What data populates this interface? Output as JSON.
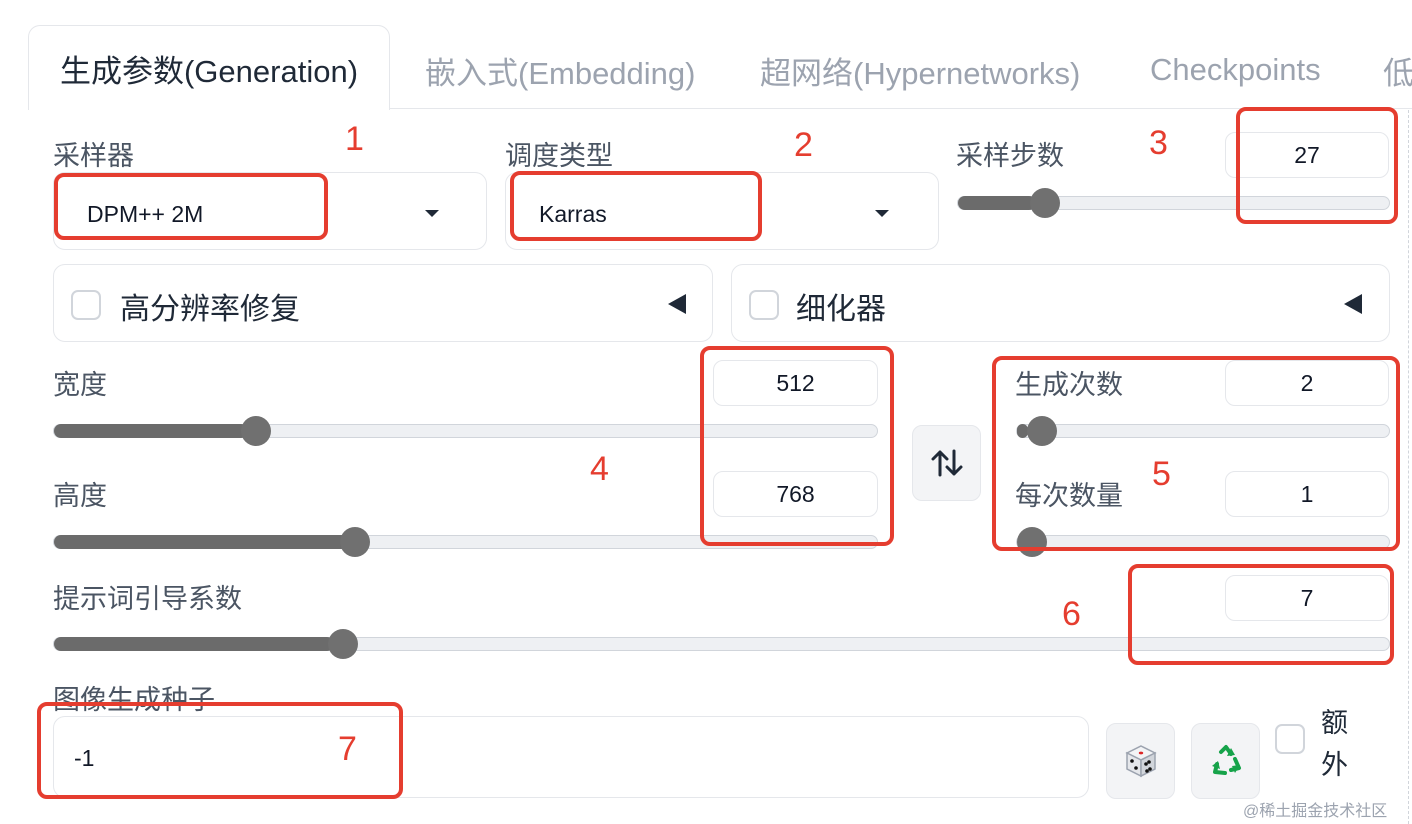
{
  "tabs": [
    {
      "label": "生成参数(Generation)",
      "active": true
    },
    {
      "label": "嵌入式(Embedding)",
      "active": false
    },
    {
      "label": "超网络(Hypernetworks)",
      "active": false
    },
    {
      "label": "Checkpoints",
      "active": false
    },
    {
      "label": "低",
      "active": false
    }
  ],
  "sampler": {
    "label": "采样器",
    "value": "DPM++ 2M"
  },
  "scheduler": {
    "label": "调度类型",
    "value": "Karras"
  },
  "steps": {
    "label": "采样步数",
    "value": "27",
    "level": 0.18
  },
  "hires_fix": {
    "label": "高分辨率修复"
  },
  "refiner": {
    "label": "细化器"
  },
  "width": {
    "label": "宽度",
    "value": "512",
    "level": 0.236
  },
  "height": {
    "label": "高度",
    "value": "768",
    "level": 0.361
  },
  "swap_icon": "swap-arrows-icon",
  "batch_count": {
    "label": "生成次数",
    "value": "2",
    "level": 0.03
  },
  "batch_size": {
    "label": "每次数量",
    "value": "1",
    "level": 0.0
  },
  "cfg_scale": {
    "label": "提示词引导系数",
    "value": "7",
    "level": 0.21
  },
  "seed": {
    "label": "图像生成种子",
    "value": "-1",
    "dice_icon": "dice-icon",
    "recycle_icon": "recycle-icon"
  },
  "extra": {
    "label_line1": "额",
    "label_line2": "外"
  },
  "annotations": [
    "1",
    "2",
    "3",
    "4",
    "5",
    "6",
    "7"
  ],
  "watermark": "@稀土掘金技术社区",
  "colors": {
    "annotation_red": "#e53d2f",
    "slider_fill": "#6b6b6b"
  }
}
